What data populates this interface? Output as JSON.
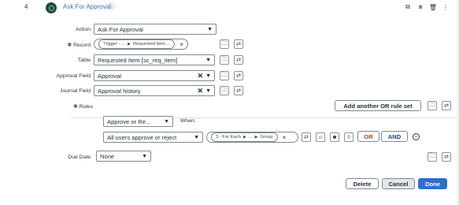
{
  "step": {
    "number": "4",
    "title": "Ask For Approval",
    "icons": [
      "copy-icon",
      "stack-icon",
      "trash-icon",
      "more-icon"
    ]
  },
  "action": {
    "label": "Action",
    "value": "Ask For Approval"
  },
  "record": {
    "label": "Record",
    "pill_parts": [
      "Trigger - ...",
      "Requested Item ..."
    ]
  },
  "table": {
    "label": "Table",
    "value": "Requested Item [sc_req_item]"
  },
  "approval_field": {
    "label": "Approval Field",
    "value": "Approval"
  },
  "journal_field": {
    "label": "Journal Field",
    "value": "Approval history"
  },
  "rules": {
    "label": "Rules",
    "add_or_rule_set_label": "Add another OR rule set",
    "approve_select": "Approve or Re...",
    "when_label": "When:",
    "condition_select": "All users approve or reject",
    "pill_parts": [
      "3 - For Each",
      "...",
      "Group"
    ],
    "or_label": "OR",
    "and_label": "AND"
  },
  "due_date": {
    "label": "Due Date",
    "value": "None"
  },
  "footer": {
    "delete_label": "Delete",
    "cancel_label": "Cancel",
    "done_label": "Done"
  }
}
